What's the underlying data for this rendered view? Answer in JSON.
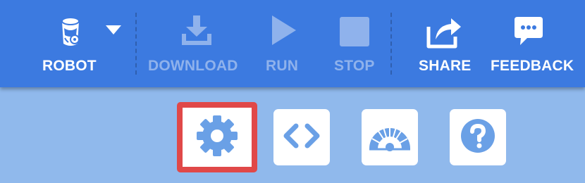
{
  "toolbar": {
    "robot_label": "ROBOT",
    "download_label": "DOWNLOAD",
    "run_label": "RUN",
    "stop_label": "STOP",
    "share_label": "SHARE",
    "feedback_label": "FEEDBACK"
  },
  "tabs": [
    {
      "name": "settings",
      "icon": "gear-icon",
      "selected": true
    },
    {
      "name": "code",
      "icon": "code-brackets-icon",
      "selected": false
    },
    {
      "name": "dashboard",
      "icon": "gauge-icon",
      "selected": false
    },
    {
      "name": "help",
      "icon": "question-icon",
      "selected": false
    }
  ],
  "colors": {
    "toolbar_bg": "#3c7ae0",
    "page_bg": "#90b9ec",
    "disabled": "#8fb2ec",
    "selection_border": "#e04848",
    "icon_blue": "#6aa0e6"
  }
}
